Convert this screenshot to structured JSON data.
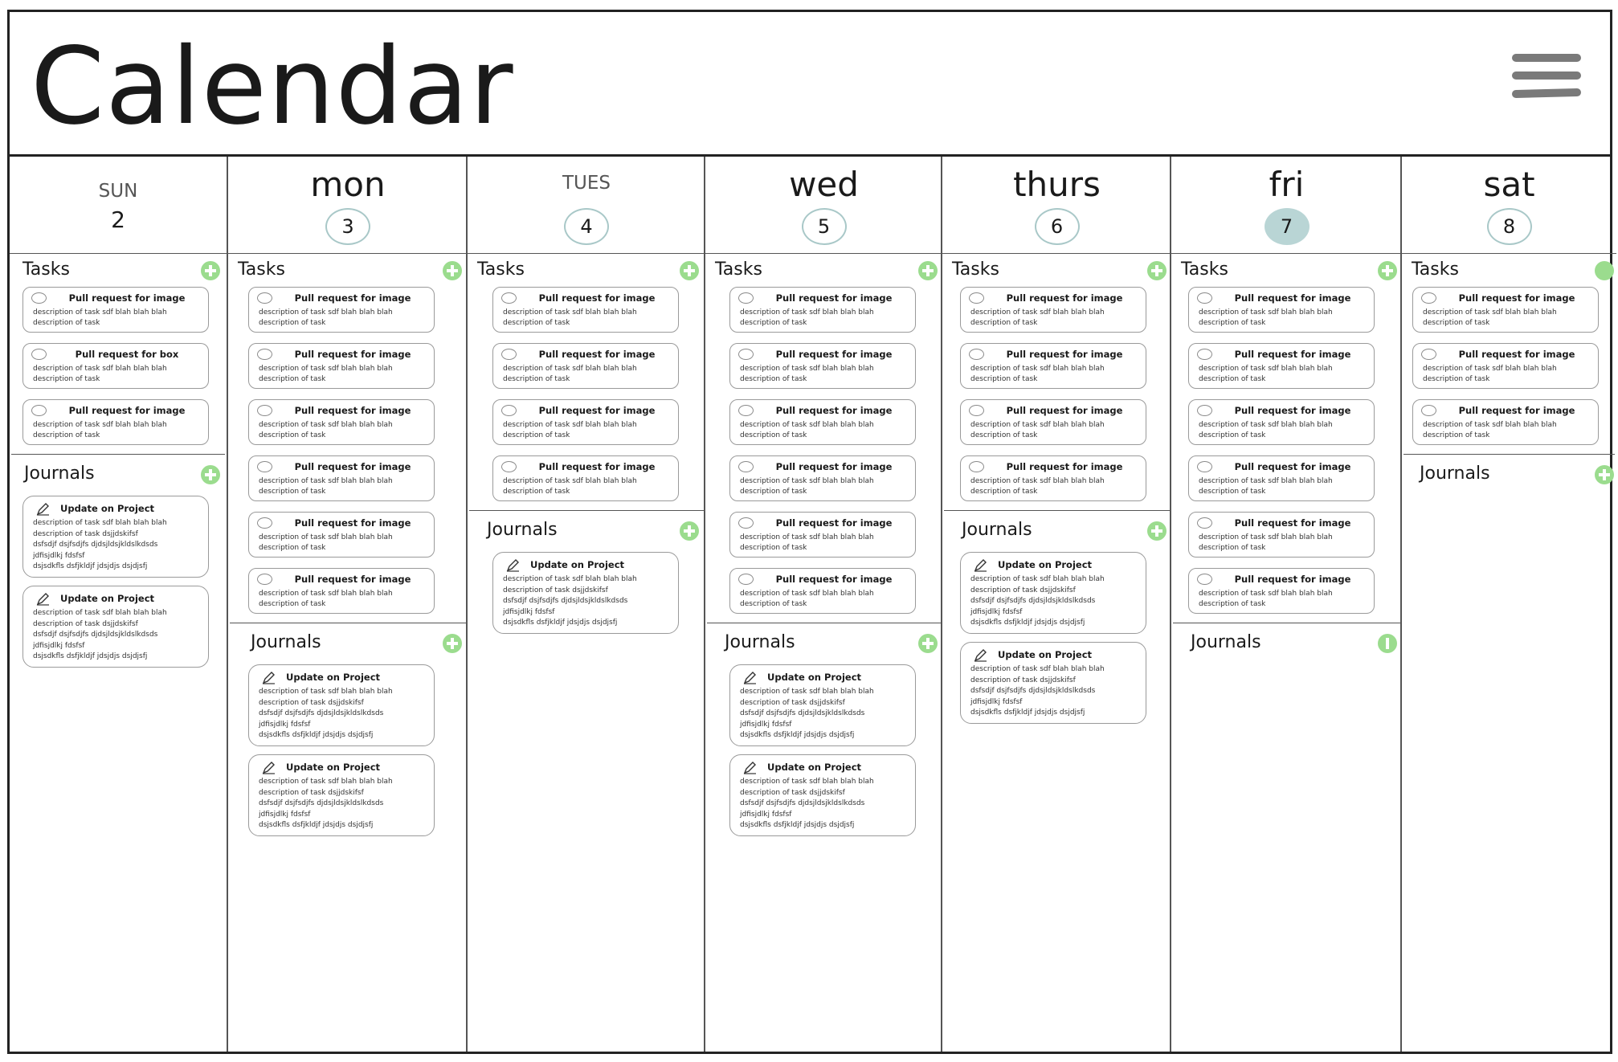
{
  "app": {
    "title": "Calendar",
    "menu_icon": "hamburger-menu-icon"
  },
  "colors": {
    "accent_green": "#9bdc8e",
    "selected_day": "#b9d5d5",
    "day_ring": "#a9c8c8"
  },
  "labels": {
    "tasks": "Tasks",
    "journals": "Journals"
  },
  "days": [
    {
      "name": "SUN",
      "date": "2",
      "tasks": [
        {
          "title": "Pull request for image",
          "desc": "description of task sdf blah blah blah\ndescription of task"
        },
        {
          "title": "Pull request for box",
          "desc": "description of task sdf blah blah blah\ndescription of task"
        },
        {
          "title": "Pull request for image",
          "desc": "description of task sdf blah blah blah\ndescription of task"
        }
      ],
      "journals": [
        {
          "title": "Update on Project",
          "desc": "description of task sdf blah blah blah\ndescription of task dsjjdskifsf\ndsfsdjf dsjfsdjfs djdsjldsjkldslkdsds\njdfisjdlkj fdsfsf\ndsjsdkfls dsfjkldjf jdsjdjs dsjdjsfj"
        },
        {
          "title": "Update on Project",
          "desc": "description of task sdf blah blah blah\ndescription of task dsjjdskifsf\ndsfsdjf dsjfsdjfs djdsjldsjkldslkdsds\njdfisjdlkj fdsfsf\ndsjsdkfls dsfjkldjf jdsjdjs dsjdjsfj"
        }
      ]
    },
    {
      "name": "mon",
      "date": "3",
      "tasks": [
        {
          "title": "Pull request for image",
          "desc": "description of task sdf blah blah blah\ndescription of task"
        },
        {
          "title": "Pull request for image",
          "desc": "description of task sdf blah blah blah\ndescription of task"
        },
        {
          "title": "Pull request for image",
          "desc": "description of task sdf blah blah blah\ndescription of task"
        },
        {
          "title": "Pull request for image",
          "desc": "description of task sdf blah blah blah\ndescription of task"
        },
        {
          "title": "Pull request for image",
          "desc": "description of task sdf blah blah blah\ndescription of task"
        },
        {
          "title": "Pull request for image",
          "desc": "description of task sdf blah blah blah\ndescription of task"
        }
      ],
      "journals": [
        {
          "title": "Update on Project",
          "desc": "description of task sdf blah blah blah\ndescription of task dsjjdskifsf\ndsfsdjf dsjfsdjfs djdsjldsjkldslkdsds\njdfisjdlkj fdsfsf\ndsjsdkfls dsfjkldjf jdsjdjs dsjdjsfj"
        },
        {
          "title": "Update on Project",
          "desc": "description of task sdf blah blah blah\ndescription of task dsjjdskifsf\ndsfsdjf dsjfsdjfs djdsjldsjkldslkdsds\njdfisjdlkj fdsfsf\ndsjsdkfls dsfjkldjf jdsjdjs dsjdjsfj"
        }
      ]
    },
    {
      "name": "TUES",
      "date": "4",
      "tasks": [
        {
          "title": "Pull request for image",
          "desc": "description of task sdf blah blah blah\ndescription of task"
        },
        {
          "title": "Pull request for image",
          "desc": "description of task sdf blah blah blah\ndescription of task"
        },
        {
          "title": "Pull request for image",
          "desc": "description of task sdf blah blah blah\ndescription of task"
        },
        {
          "title": "Pull request for image",
          "desc": "description of task sdf blah blah blah\ndescription of task"
        }
      ],
      "journals": [
        {
          "title": "Update on Project",
          "desc": "description of task sdf blah blah blah\ndescription of task dsjjdskifsf\ndsfsdjf dsjfsdjfs djdsjldsjkldslkdsds\njdfisjdlkj fdsfsf\ndsjsdkfls dsfjkldjf jdsjdjs dsjdjsfj"
        }
      ]
    },
    {
      "name": "wed",
      "date": "5",
      "tasks": [
        {
          "title": "Pull request for image",
          "desc": "description of task sdf blah blah blah\ndescription of task"
        },
        {
          "title": "Pull request for image",
          "desc": "description of task sdf blah blah blah\ndescription of task"
        },
        {
          "title": "Pull request for image",
          "desc": "description of task sdf blah blah blah\ndescription of task"
        },
        {
          "title": "Pull request for image",
          "desc": "description of task sdf blah blah blah\ndescription of task"
        },
        {
          "title": "Pull request for image",
          "desc": "description of task sdf blah blah blah\ndescription of task"
        },
        {
          "title": "Pull request for image",
          "desc": "description of task sdf blah blah blah\ndescription of task"
        }
      ],
      "journals": [
        {
          "title": "Update on Project",
          "desc": "description of task sdf blah blah blah\ndescription of task dsjjdskifsf\ndsfsdjf dsjfsdjfs djdsjldsjkldslkdsds\njdfisjdlkj fdsfsf\ndsjsdkfls dsfjkldjf jdsjdjs dsjdjsfj"
        },
        {
          "title": "Update on Project",
          "desc": "description of task sdf blah blah blah\ndescription of task dsjjdskifsf\ndsfsdjf dsjfsdjfs djdsjldsjkldslkdsds\njdfisjdlkj fdsfsf\ndsjsdkfls dsfjkldjf jdsjdjs dsjdjsfj"
        }
      ]
    },
    {
      "name": "thurs",
      "date": "6",
      "tasks": [
        {
          "title": "Pull request for image",
          "desc": "description of task sdf blah blah blah\ndescription of task"
        },
        {
          "title": "Pull request for image",
          "desc": "description of task sdf blah blah blah\ndescription of task"
        },
        {
          "title": "Pull request for image",
          "desc": "description of task sdf blah blah blah\ndescription of task"
        },
        {
          "title": "Pull request for image",
          "desc": "description of task sdf blah blah blah\ndescription of task"
        }
      ],
      "journals": [
        {
          "title": "Update on Project",
          "desc": "description of task sdf blah blah blah\ndescription of task dsjjdskifsf\ndsfsdjf dsjfsdjfs djdsjldsjkldslkdsds\njdfisjdlkj fdsfsf\ndsjsdkfls dsfjkldjf jdsjdjs dsjdjsfj"
        },
        {
          "title": "Update on Project",
          "desc": "description of task sdf blah blah blah\ndescription of task dsjjdskifsf\ndsfsdjf dsjfsdjfs djdsjldsjkldslkdsds\njdfisjdlkj fdsfsf\ndsjsdkfls dsfjkldjf jdsjdjs dsjdjsfj"
        }
      ]
    },
    {
      "name": "fri",
      "date": "7",
      "selected": true,
      "tasks": [
        {
          "title": "Pull request for image",
          "desc": "description of task sdf blah blah blah\ndescription of task"
        },
        {
          "title": "Pull request for image",
          "desc": "description of task sdf blah blah blah\ndescription of task"
        },
        {
          "title": "Pull request for image",
          "desc": "description of task sdf blah blah blah\ndescription of task"
        },
        {
          "title": "Pull request for image",
          "desc": "description of task sdf blah blah blah\ndescription of task"
        },
        {
          "title": "Pull request for image",
          "desc": "description of task sdf blah blah blah\ndescription of task"
        },
        {
          "title": "Pull request for image",
          "desc": "description of task sdf blah blah blah\ndescription of task"
        }
      ],
      "journals": []
    },
    {
      "name": "sat",
      "date": "8",
      "tasks": [
        {
          "title": "Pull request for image",
          "desc": "description of task sdf blah blah blah\ndescription of task"
        },
        {
          "title": "Pull request for image",
          "desc": "description of task sdf blah blah blah\ndescription of task"
        },
        {
          "title": "Pull request for image",
          "desc": "description of task sdf blah blah blah\ndescription of task"
        }
      ],
      "journals": []
    }
  ]
}
